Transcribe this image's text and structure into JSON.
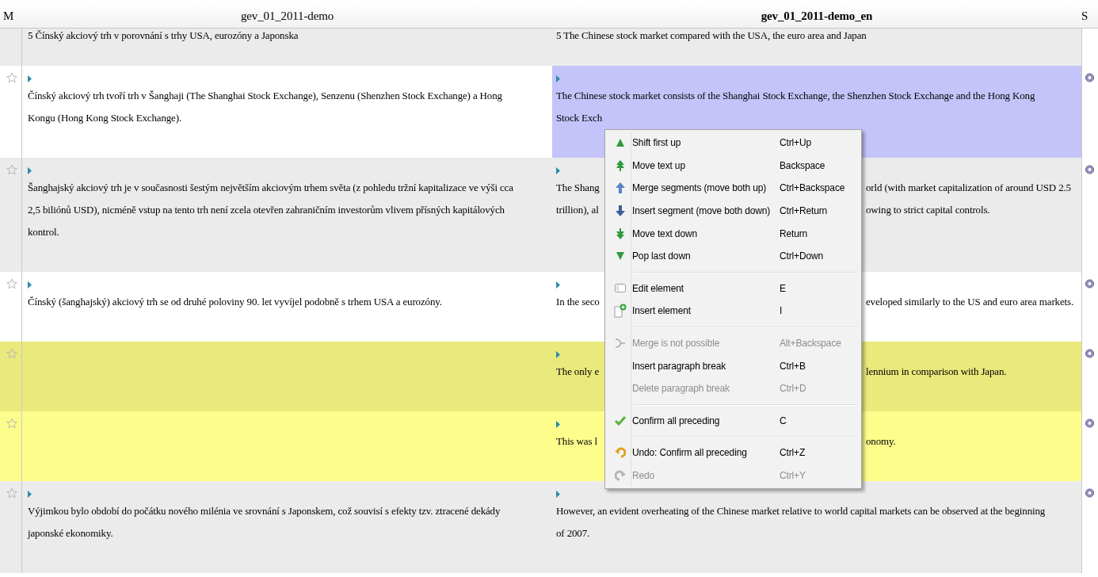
{
  "columns": [
    {
      "label": "M",
      "selected": false
    },
    {
      "label": "gev_01_2011-demo",
      "selected": false
    },
    {
      "label": "gev_01_2011-demo_en",
      "selected": true
    },
    {
      "label": "S",
      "selected": false
    }
  ],
  "rows": [
    {
      "color": "#ebebeb",
      "selected": false,
      "source": {
        "marker": false,
        "lines": [
          "5 Čínský akciový trh v porovnání s trhy USA, eurozóny a Japonska"
        ]
      },
      "target": {
        "marker": false,
        "lines": [
          [
            "5 The Chinese stock market compared with the USA, the euro area and Japan"
          ]
        ]
      }
    },
    {
      "color": "#ffffff",
      "selected": true,
      "source": {
        "marker": true,
        "lines": [
          "Čínský akciový trh tvoří trh v Šanghaji (The Shanghai Stock Exchange), Senzenu (Shenzhen Stock Exchange) a Hong",
          "Kongu (Hong Kong Stock Exchange)."
        ]
      },
      "target": {
        "marker": true,
        "lines": [
          [
            "The Chinese stock market consists of the Shanghai Stock Exchange, the Shenzhen Stock Exchange and the Hong Kong"
          ],
          [
            "Stock Exch"
          ]
        ]
      }
    },
    {
      "color": "#ebebeb",
      "selected": false,
      "source": {
        "marker": true,
        "lines": [
          "Šanghajský akciový trh je v současnosti šestým největším akciovým trhem světa (z pohledu tržní kapitalizace ve výši cca",
          "2,5 biliónů USD), nicméně vstup na tento trh není zcela otevřen zahraničním investorům vlivem přísných kapitálových",
          "kontrol."
        ]
      },
      "target": {
        "marker": true,
        "lines": [
          [
            "The Shang",
            "orld (with market capitalization of around USD 2.5"
          ],
          [
            "trillion), al",
            "owing to strict capital controls."
          ]
        ]
      }
    },
    {
      "color": "#ffffff",
      "selected": false,
      "source": {
        "marker": true,
        "lines": [
          "Čínský (šanghajský) akciový trh se od druhé poloviny 90. let vyvíjel podobně s trhem USA a eurozóny."
        ]
      },
      "target": {
        "marker": true,
        "lines": [
          [
            "In the seco",
            "eveloped similarly to the US and euro area markets."
          ]
        ]
      }
    },
    {
      "color": "#e9e97c",
      "selected": false,
      "source": {
        "marker": false
      },
      "target": {
        "marker": true,
        "lines": [
          [
            "The only e",
            "lennium in comparison with Japan."
          ]
        ]
      }
    },
    {
      "color": "#fdfd8c",
      "selected": false,
      "source": {
        "marker": false
      },
      "target": {
        "marker": true,
        "lines": [
          [
            "This was l",
            "onomy."
          ]
        ]
      }
    },
    {
      "color": "#ebebeb",
      "selected": false,
      "source": {
        "marker": true,
        "lines": [
          "Výjimkou bylo období do počátku nového milénia ve srovnání s Japonskem, což souvisí s efekty tzv. ztracené dekády",
          "japonské ekonomiky."
        ]
      },
      "target": {
        "marker": true,
        "lines": [
          [
            "However, an evident overheating of the Chinese market relative to world capital markets can be observed at the beginning"
          ],
          [
            "of 2007."
          ]
        ]
      }
    }
  ],
  "context_menu": [
    {
      "kind": "item",
      "label": "Shift first up",
      "shortcut": "Ctrl+Up",
      "disabled": false
    },
    {
      "kind": "item",
      "label": "Move text up",
      "shortcut": "Backspace",
      "disabled": false
    },
    {
      "kind": "item",
      "label": "Merge segments (move both up)",
      "shortcut": "Ctrl+Backspace",
      "disabled": false
    },
    {
      "kind": "item",
      "label": "Insert segment (move both down)",
      "shortcut": "Ctrl+Return",
      "disabled": false
    },
    {
      "kind": "item",
      "label": "Move text down",
      "shortcut": "Return",
      "disabled": false
    },
    {
      "kind": "item",
      "label": "Pop last down",
      "shortcut": "Ctrl+Down",
      "disabled": false
    },
    {
      "kind": "separator"
    },
    {
      "kind": "item",
      "label": "Edit element",
      "shortcut": "E",
      "disabled": false
    },
    {
      "kind": "item",
      "label": "Insert element",
      "shortcut": "I",
      "disabled": false
    },
    {
      "kind": "separator"
    },
    {
      "kind": "item",
      "label": "Merge is not possible",
      "shortcut": "Alt+Backspace",
      "disabled": true
    },
    {
      "kind": "item",
      "label": "Insert paragraph break",
      "shortcut": "Ctrl+B",
      "disabled": false
    },
    {
      "kind": "item",
      "label": "Delete paragraph break",
      "shortcut": "Ctrl+D",
      "disabled": true
    },
    {
      "kind": "separator"
    },
    {
      "kind": "item",
      "label": "Confirm all preceding",
      "shortcut": "C",
      "disabled": false
    },
    {
      "kind": "separator"
    },
    {
      "kind": "item",
      "label": "Undo: Confirm all preceding",
      "shortcut": "Ctrl+Z",
      "disabled": false
    },
    {
      "kind": "item",
      "label": "Redo",
      "shortcut": "Ctrl+Y",
      "disabled": true
    }
  ]
}
